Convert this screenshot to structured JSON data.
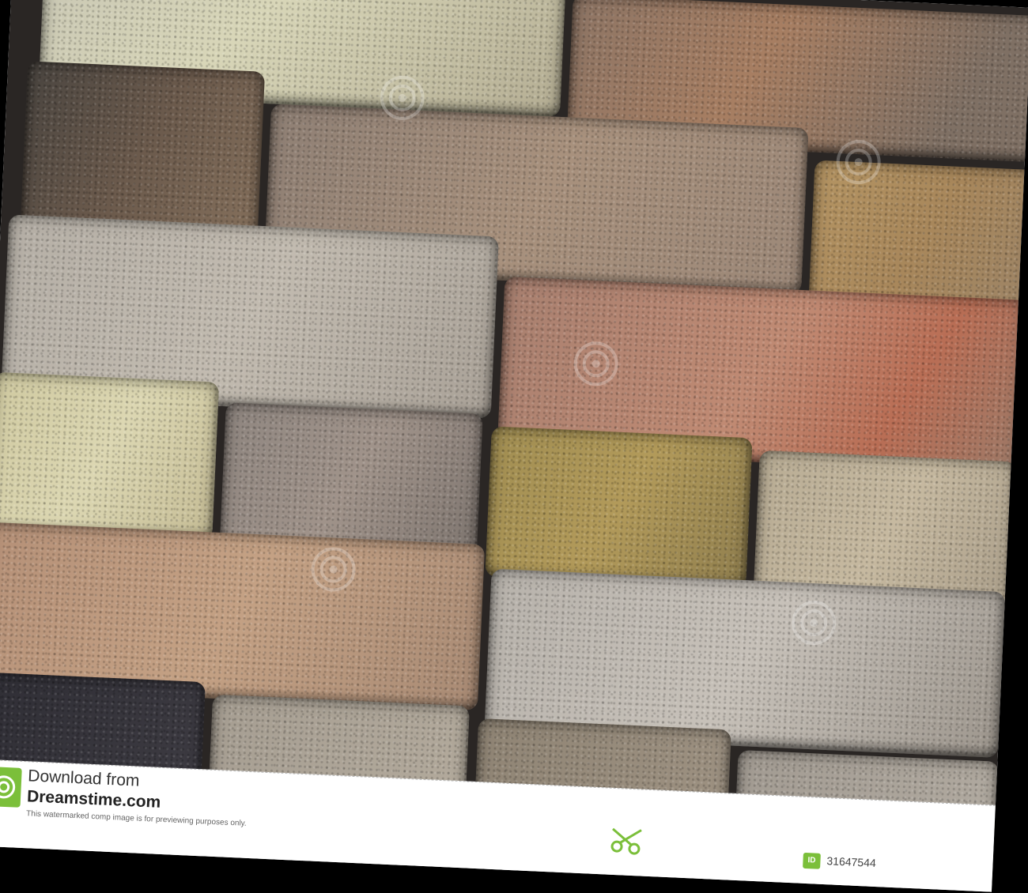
{
  "footer": {
    "download_from": "Download from",
    "site_name": "Dreamstime.com",
    "note": "This watermarked comp image is for previewing purposes only.",
    "id_label": "ID",
    "id_number": "31647544"
  },
  "colors": {
    "brand_green": "#7bbf3a",
    "mortar": "#2a2624"
  },
  "icons": [
    "dreamstime-logo-icon",
    "scissors-icon",
    "watermark-spiral-icon"
  ]
}
